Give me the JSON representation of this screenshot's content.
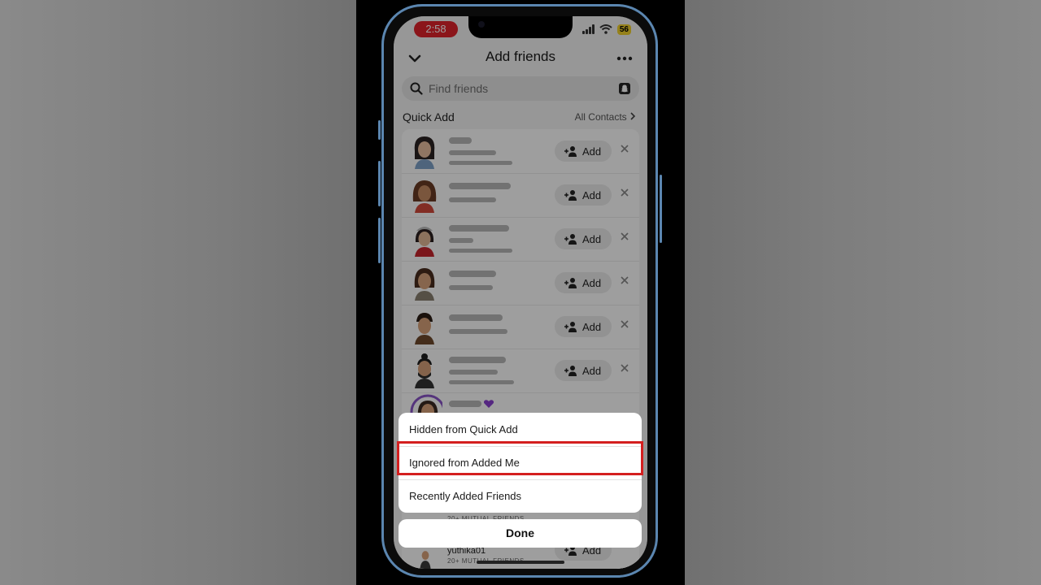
{
  "status_bar": {
    "time": "2:58",
    "battery": "56"
  },
  "header": {
    "title": "Add friends"
  },
  "search": {
    "placeholder": "Find friends"
  },
  "quick_add": {
    "label": "Quick Add",
    "all_contacts": "All Contacts"
  },
  "friend_rows": [
    {
      "add_label": "Add"
    },
    {
      "add_label": "Add"
    },
    {
      "add_label": "Add"
    },
    {
      "add_label": "Add"
    },
    {
      "add_label": "Add"
    },
    {
      "add_label": "Add"
    }
  ],
  "partial_rows": {
    "mutual_1": "20+ MUTUAL FRIENDS",
    "username": "yuthika01",
    "mutual_2": "20+ MUTUAL FRIENDS",
    "add_label": "Add"
  },
  "sheet": {
    "items": [
      {
        "label": "Hidden from Quick Add"
      },
      {
        "label": "Ignored from Added Me"
      },
      {
        "label": "Recently Added Friends"
      }
    ],
    "done_label": "Done",
    "highlight_color": "#d41f1f"
  },
  "icons": {
    "back": "chevron-down-icon",
    "more": "more-dots-icon",
    "search": "search-icon",
    "ghost": "snapchat-ghost-icon",
    "add": "add-friend-icon",
    "dismiss": "close-icon"
  }
}
